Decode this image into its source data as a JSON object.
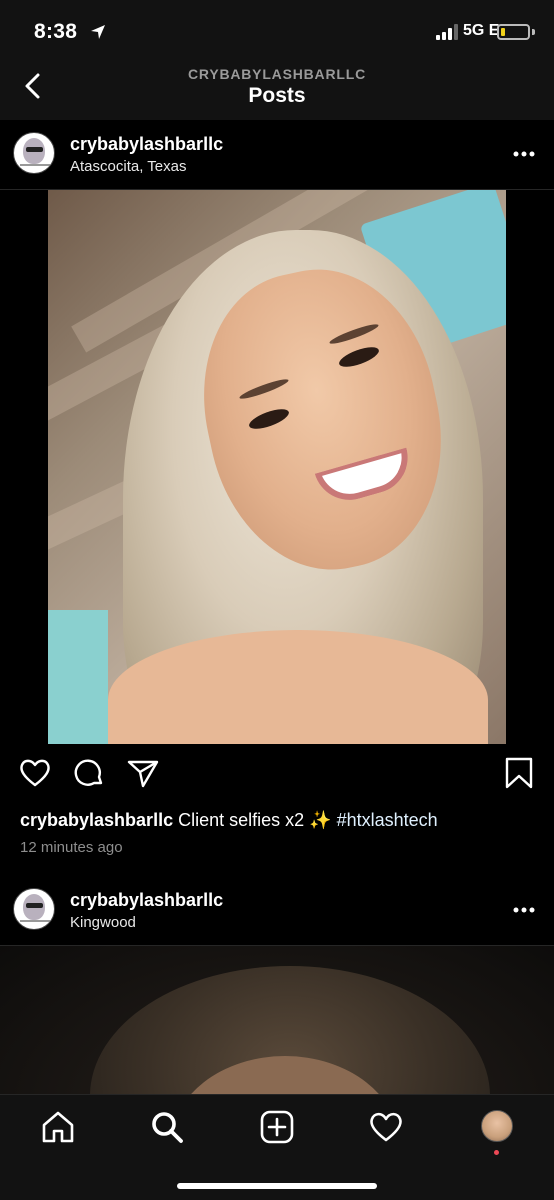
{
  "status_bar": {
    "time": "8:38",
    "network": "5G E",
    "battery_level": 0.15,
    "battery_color": "#f0d11a"
  },
  "header": {
    "back_icon": "chevron-left-icon",
    "subtitle": "CRYBABYLASHBARLLC",
    "title": "Posts"
  },
  "posts": [
    {
      "username": "crybabylashbarllc",
      "location": "Atascocita, Texas",
      "more_icon": "ellipsis-icon",
      "caption_text": "Client selfies x2 ✨",
      "hashtag": "#htxlashtech",
      "timestamp": "12 minutes ago",
      "actions": [
        "heart-icon",
        "comment-icon",
        "share-icon",
        "bookmark-icon"
      ]
    },
    {
      "username": "crybabylashbarllc",
      "location": "Kingwood",
      "more_icon": "ellipsis-icon"
    }
  ],
  "bottom_nav": {
    "items": [
      "home-icon",
      "search-icon",
      "add-post-icon",
      "activity-heart-icon",
      "profile-avatar"
    ],
    "notification_color": "#ed4956"
  }
}
